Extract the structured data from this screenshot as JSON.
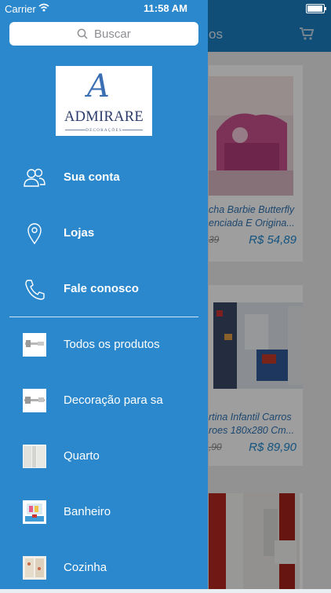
{
  "status_bar": {
    "carrier": "Carrier",
    "time": "11:58 AM"
  },
  "background": {
    "header_title": "os",
    "products": [
      {
        "title": "cha Barbie Butterfly enciada E Origina...",
        "old_price": "39",
        "price": "R$ 54,89"
      },
      {
        "title": "rtina Infantil Carros roes 180x280 Cm...",
        "old_price": ",90",
        "price": "R$ 89,90"
      }
    ]
  },
  "drawer": {
    "search_placeholder": "Buscar",
    "logo": {
      "mark": "A",
      "name": "ADMIRARE",
      "sub": "DECORAÇÕES"
    },
    "account_items": [
      {
        "label": "Sua conta",
        "icon": "users-icon"
      },
      {
        "label": "Lojas",
        "icon": "map-pin-icon"
      },
      {
        "label": "Fale conosco",
        "icon": "phone-icon"
      }
    ],
    "categories": [
      {
        "label": "Todos os produtos",
        "icon": "curtain-rod-thumbnail"
      },
      {
        "label": "Decoração para sa",
        "icon": "curtain-rod-thumbnail"
      },
      {
        "label": "Quarto",
        "icon": "curtain-thumbnail"
      },
      {
        "label": "Banheiro",
        "icon": "bathroom-thumbnail"
      },
      {
        "label": "Cozinha",
        "icon": "kitchen-curtain-thumbnail"
      }
    ]
  },
  "colors": {
    "drawer": "#2b88cc",
    "header": "#1c7fc1",
    "price": "#1f86cf"
  }
}
